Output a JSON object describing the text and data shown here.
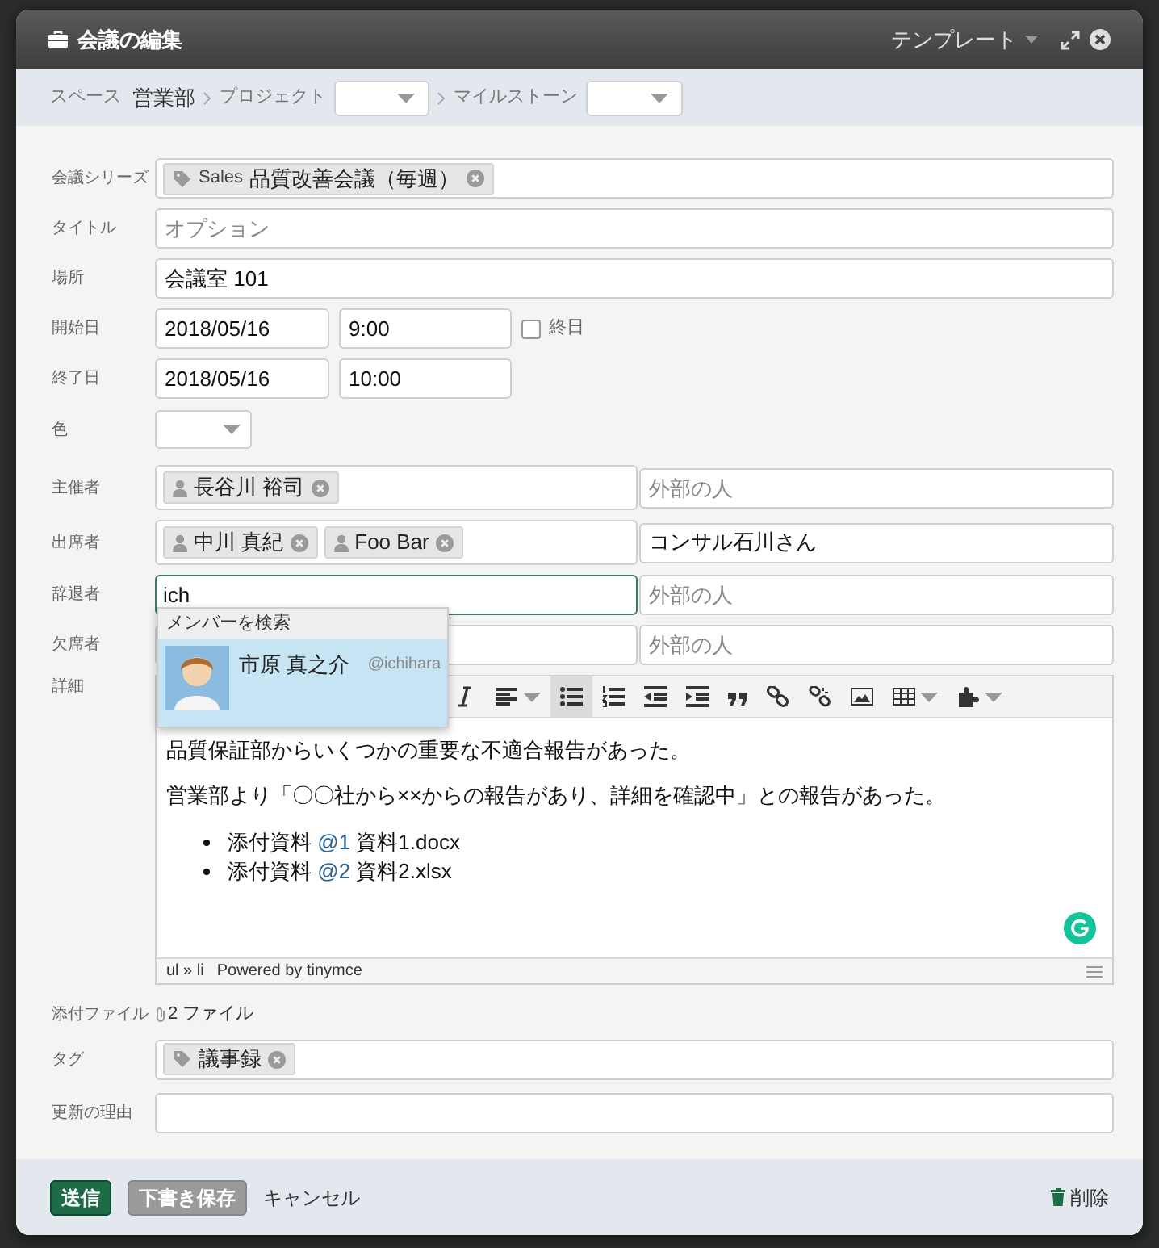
{
  "dialog": {
    "title": "会議の編集",
    "template_menu": "テンプレート"
  },
  "breadcrumb": {
    "space_label": "スペース",
    "space": "営業部",
    "project_label": "プロジェクト",
    "milestone_label": "マイルストーン"
  },
  "series": {
    "label": "会議シリーズ",
    "tags": [
      {
        "prefix": "Sales",
        "text": "品質改善会議（毎週）"
      }
    ]
  },
  "title_field": {
    "label": "タイトル",
    "placeholder": "オプション"
  },
  "location": {
    "label": "場所",
    "value": "会議室 101"
  },
  "start": {
    "label": "開始日",
    "date": "2018/05/16",
    "time": "9:00",
    "all_day": {
      "label": "終日",
      "checked": false
    }
  },
  "end": {
    "label": "終了日",
    "date": "2018/05/16",
    "time": "10:00"
  },
  "color": {
    "label": "色"
  },
  "people": [
    {
      "label": "主催者",
      "members": [
        "長谷川 裕司"
      ],
      "focused": false,
      "external": {
        "placeholder": "外部の人"
      }
    },
    {
      "label": "出席者",
      "members": [
        "中川 真紀",
        "Foo Bar"
      ],
      "focused": false,
      "external": {
        "value": "コンサル石川さん"
      }
    },
    {
      "label": "辞退者",
      "typed": "ich",
      "focused": true,
      "external": {
        "placeholder": "外部の人"
      }
    },
    {
      "label": "欠席者",
      "focused": false,
      "external": {
        "placeholder": "外部の人"
      }
    }
  ],
  "autocomplete": {
    "header": "メンバーを検索",
    "results": [
      {
        "name": "市原 真之介",
        "handle": "@ichihara",
        "selected": true
      }
    ]
  },
  "details": {
    "label": "詳細",
    "toolbar": [
      {
        "kind": "italic",
        "active": false
      },
      {
        "kind": "align",
        "active": false
      },
      {
        "kind": "bullets",
        "active": true
      },
      {
        "kind": "numbers",
        "active": false
      },
      {
        "kind": "outdent",
        "active": false
      },
      {
        "kind": "indent",
        "active": false
      },
      {
        "kind": "quote",
        "active": false
      },
      {
        "kind": "link",
        "active": false
      },
      {
        "kind": "unlink",
        "active": false
      },
      {
        "kind": "image",
        "active": false
      },
      {
        "kind": "table",
        "active": false
      },
      {
        "kind": "plugin",
        "active": false
      }
    ],
    "paragraphs": [
      "品質保証部からいくつかの重要な不適合報告があった。",
      "営業部より「〇〇社から××からの報告があり、詳細を確認中」との報告があった。"
    ],
    "list": [
      {
        "text": "添付資料",
        "ref": "@1",
        "file": "資料1.docx"
      },
      {
        "text": "添付資料",
        "ref": "@2",
        "file": "資料2.xlsx"
      }
    ],
    "status_path": "ul » li",
    "powered": "Powered by tinymce"
  },
  "attachments": {
    "label": "添付ファイル",
    "count": "2 ファイル"
  },
  "tags": {
    "label": "タグ",
    "tags": [
      "議事録"
    ]
  },
  "reason": {
    "label": "更新の理由"
  },
  "footer": {
    "submit": "送信",
    "draft": "下書き保存",
    "cancel": "キャンセル",
    "delete": "削除"
  }
}
